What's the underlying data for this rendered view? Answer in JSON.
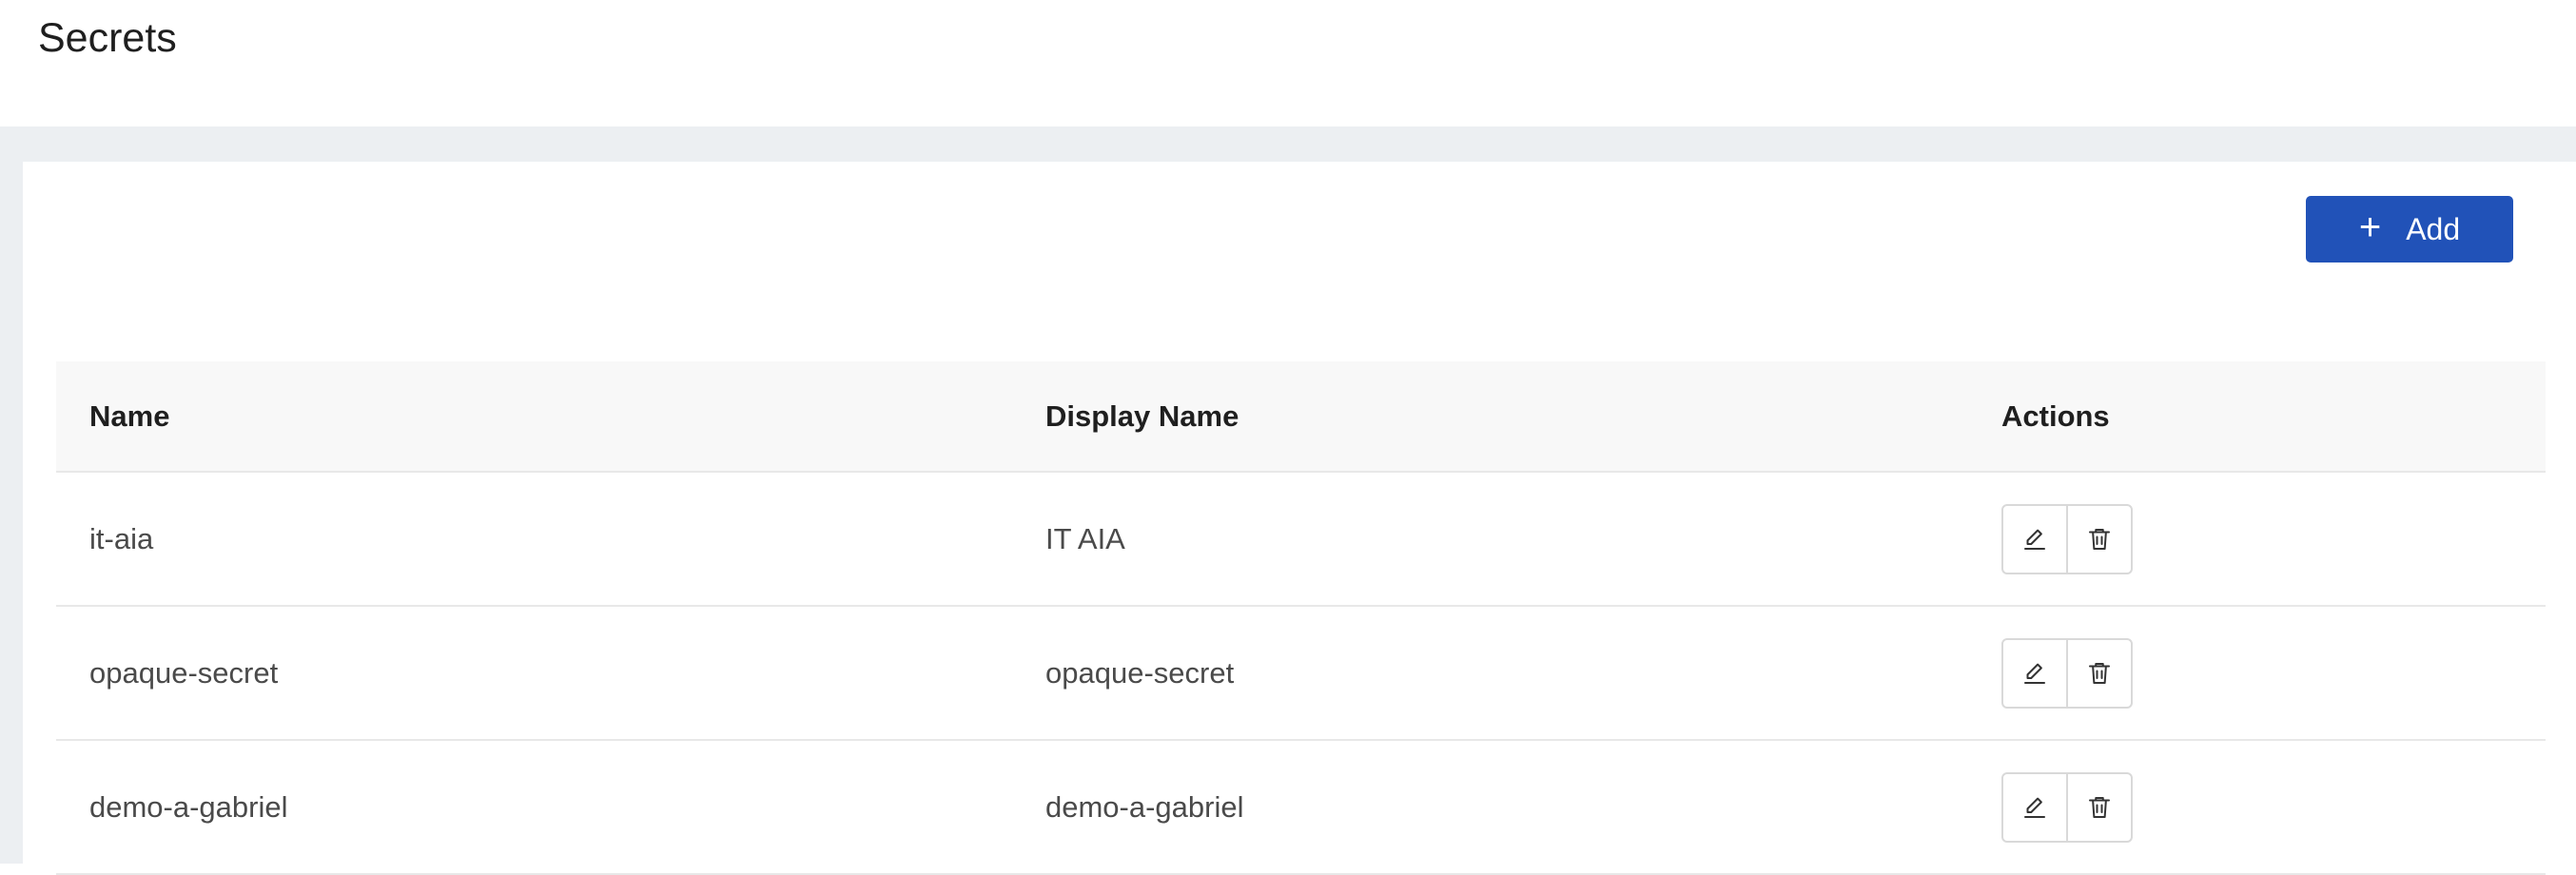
{
  "page": {
    "title": "Secrets"
  },
  "toolbar": {
    "add_label": "Add",
    "add_icon": "plus-icon",
    "accent_color": "#2152b8"
  },
  "table": {
    "columns": [
      "Name",
      "Display Name",
      "Actions"
    ],
    "rows": [
      {
        "name": "it-aia",
        "display_name": "IT AIA",
        "actions": [
          "edit-icon",
          "delete-icon"
        ]
      },
      {
        "name": "opaque-secret",
        "display_name": "opaque-secret",
        "actions": [
          "edit-icon",
          "delete-icon"
        ]
      },
      {
        "name": "demo-a-gabriel",
        "display_name": "demo-a-gabriel",
        "actions": [
          "edit-icon",
          "delete-icon"
        ]
      }
    ]
  }
}
